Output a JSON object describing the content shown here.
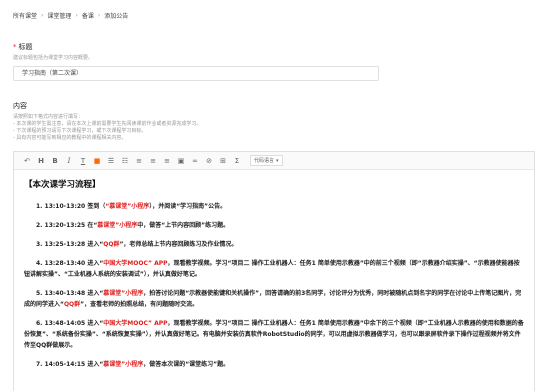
{
  "breadcrumb": [
    "所有课堂",
    "课堂管理",
    "备课",
    "添加公告"
  ],
  "title_section": {
    "label": "标题",
    "hint": "建议标题包括为课堂学习内容概要。",
    "value": "学习指南（第二次课）"
  },
  "content_section": {
    "label": "内容",
    "hints": [
      "请按照如下格式内容进行填写：",
      "- 本次课的学生需注意，请在本次上课前需要学生先阅读课前作业或者资源完成学习。",
      "- 下次课程的预习请写下次课程学习，或下次课程学习目标。",
      "- 具有内容可能写到相应的教程中的课程相关内容。"
    ]
  },
  "toolbar": {
    "items": [
      "undo-icon",
      "heading-icon",
      "bold-icon",
      "italic-icon",
      "text-color-icon",
      "highlight-icon",
      "unordered-list-icon",
      "ordered-list-icon",
      "align-left-icon",
      "align-center-icon",
      "align-right-icon",
      "image-icon",
      "link-icon",
      "attachment-icon",
      "table-icon",
      "formula-icon"
    ],
    "labels": [
      "↶",
      "H",
      "B",
      "I",
      "T",
      "■",
      "☰",
      "☷",
      "≡",
      "≡",
      "≡",
      "▣",
      "∞",
      "⊘",
      "⊞",
      "Σ"
    ],
    "highlight_color": "#ff6a00",
    "font_select": "代码语言"
  },
  "doc": {
    "heading": "【本次课学习流程】",
    "p1_a": "1.  13:10-13:20 签到（",
    "p1_b": "“慕课堂”小程序",
    "p1_c": "），并阅读“学习指南”公告。",
    "p2_a": "2.  13:20-13:25 在“",
    "p2_b": "慕课堂”小程序",
    "p2_c": "中，做答“上节内容回顾”练习题。",
    "p3_a": "3.  13:25-13:28 进入“",
    "p3_b": "QQ群",
    "p3_c": "”，老师总结上节内容回顾练习及作业情况。",
    "p4_a": "4.  13:28-13:40 进入“",
    "p4_b": "中国大学MOOC” APP",
    "p4_c": "，观看教学视频。学习“项目二 操作工业机器人：任务1 简单使用示教器”中的前三个视频（即“示教器介绍实操”、“示教器使能器按钮讲解实操”、“工业机器人系统的安装调试”），并认真做好笔记。",
    "p5_a": "5.  13:40-13:48 进入“",
    "p5_b": "慕课堂”小程序",
    "p5_c": "，拍答讨论问题“示教器使能键和关机操作”，回答请确的前3名同学，讨论评分为优秀，同时被随机点到名字的同学在讨论中上传笔记图片，完成的同学进入“",
    "p5_d": "QQ群",
    "p5_e": "”，查看老师的拍照总结，有问题随时交流。",
    "p6_a": "6.  13:48-14:05 进入“",
    "p6_b": "中国大学MOOC” APP",
    "p6_c": "，观看教学视频。学习“项目二 操作工业机器人：任务1 简单使用示教器”中余下的三个视频（即“工业机器人示教器的使用和数据的备份恢复”、“系统备份实操”、“系统恢复实操”），并认真做好笔记。有电脑并安装仿真软件RobotStudio的同学，可以用虚拟示教器做学习，也可以跟录屏软件录下操作过程视频并将文件传至QQ群做展示。",
    "p7_a": "7.  14:05-14:15 进入“",
    "p7_b": "慕课堂”小程序",
    "p7_c": "，做答本次课的“课堂练习”题。"
  }
}
